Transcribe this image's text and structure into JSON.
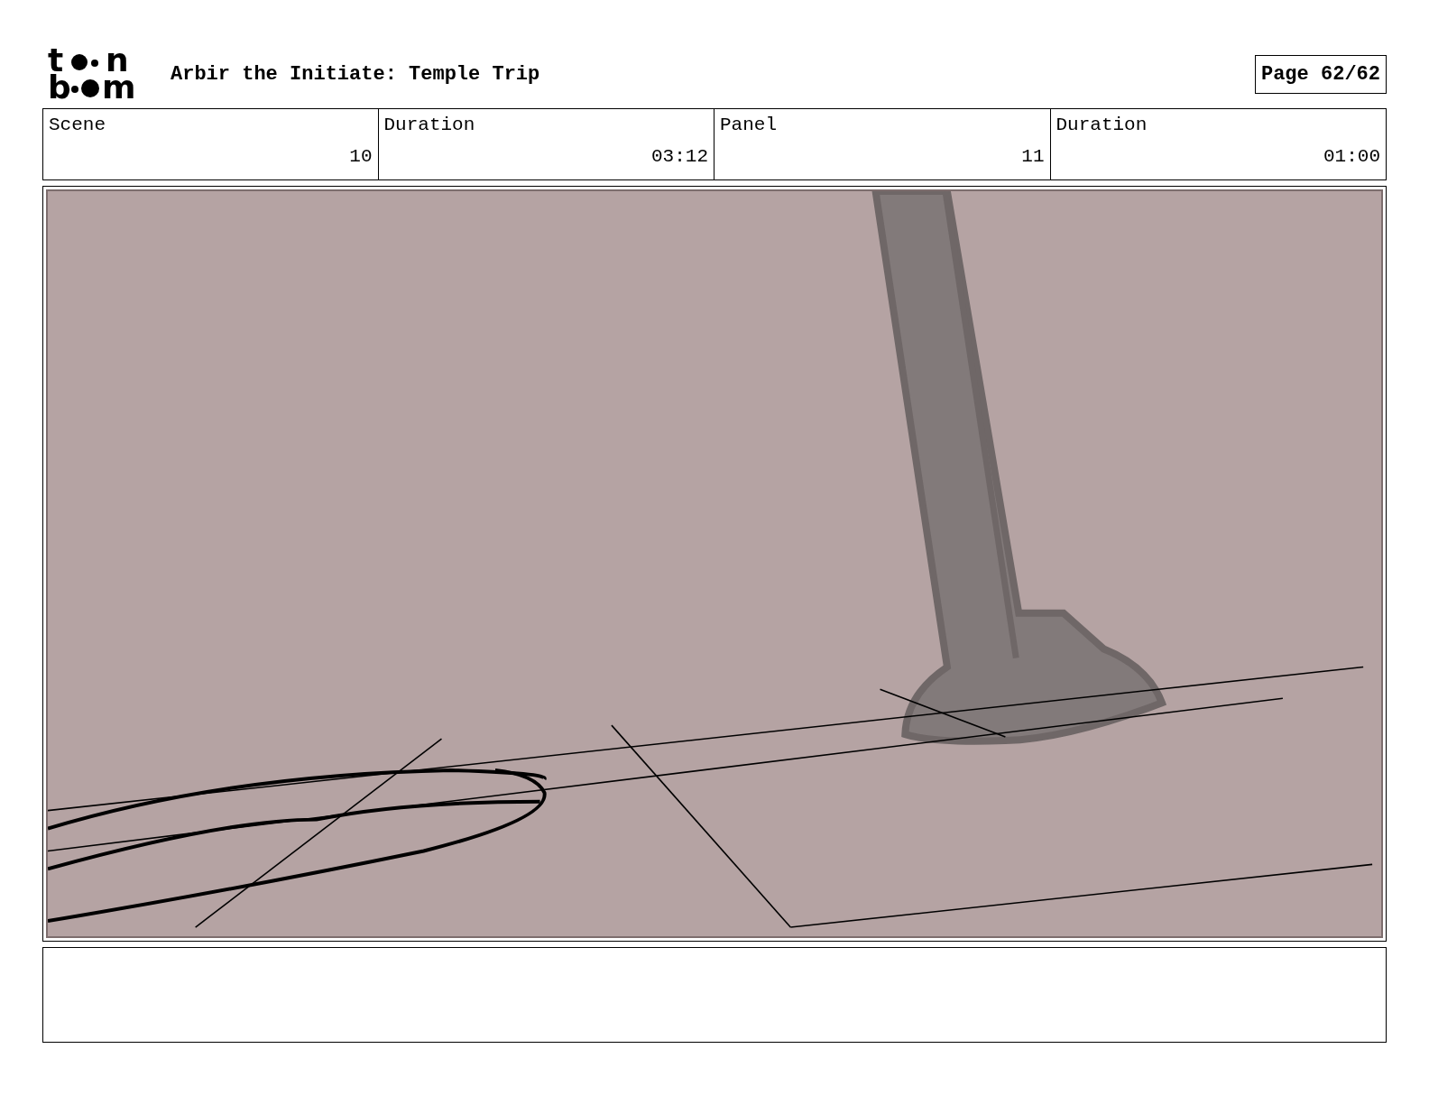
{
  "logo": {
    "letters": [
      "t",
      "n",
      "b",
      "m"
    ]
  },
  "title": "Arbir the Initiate: Temple Trip",
  "page": "Page 62/62",
  "table": {
    "columns": [
      "Scene",
      "Duration",
      "Panel",
      "Duration"
    ],
    "rows": [
      [
        "10",
        "03:12",
        "11",
        "01:00"
      ]
    ]
  }
}
